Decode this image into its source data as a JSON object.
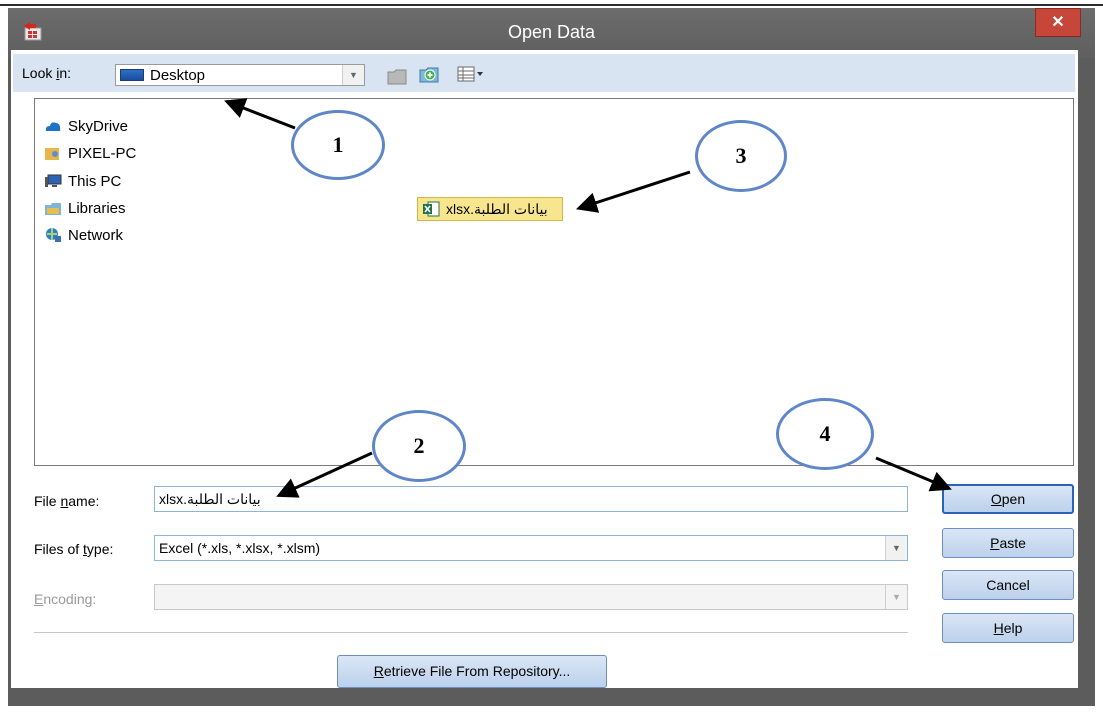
{
  "window": {
    "title": "Open Data",
    "close_glyph": "✕"
  },
  "look_in": {
    "label_pre": "Look ",
    "label_key": "i",
    "label_post": "n:",
    "value": "Desktop"
  },
  "tree_items": [
    {
      "label": "SkyDrive",
      "icon": "cloud-icon"
    },
    {
      "label": "PIXEL-PC",
      "icon": "user-folder-icon"
    },
    {
      "label": "This PC",
      "icon": "computer-icon"
    },
    {
      "label": "Libraries",
      "icon": "library-icon"
    },
    {
      "label": "Network",
      "icon": "network-icon"
    }
  ],
  "file_item": {
    "name": "بيانات الطلبة.xlsx",
    "icon": "excel-file-icon"
  },
  "file_name": {
    "label_pre": "File ",
    "label_key": "n",
    "label_post": "ame:",
    "value": "بيانات الطلبة.xlsx"
  },
  "files_of_type": {
    "label_pre": "Files of ",
    "label_key": "t",
    "label_post": "ype:",
    "value": "Excel (*.xls, *.xlsx, *.xlsm)"
  },
  "encoding": {
    "label_key": "E",
    "label_post": "ncoding:",
    "value": ""
  },
  "buttons": {
    "open": {
      "key": "O",
      "rest": "pen"
    },
    "paste": {
      "key": "P",
      "rest": "aste"
    },
    "cancel": {
      "label": "Cancel"
    },
    "help": {
      "key": "H",
      "rest": "elp"
    },
    "retrieve": {
      "key": "R",
      "rest": "etrieve File From Repository..."
    }
  },
  "callouts": [
    "1",
    "2",
    "3",
    "4"
  ],
  "colors": {
    "title_bg": "#636363",
    "close": "#c7463a",
    "button": "#c9daf0",
    "callout_border": "#5e86c8",
    "selection": "#f7e68e"
  }
}
